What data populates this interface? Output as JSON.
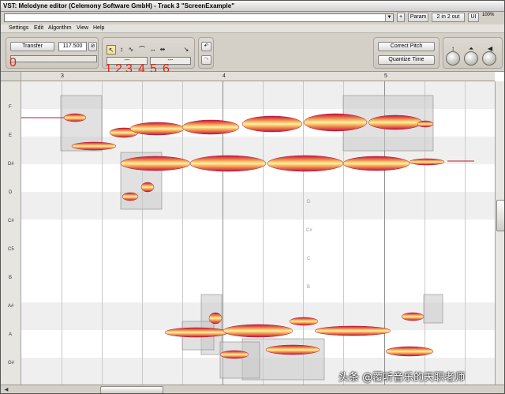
{
  "window": {
    "title": "VST: Melodyne editor (Celemony Software GmbH) - Track 3 \"ScreenExample\""
  },
  "topbar": {
    "plus_label": "+",
    "param_label": "Param",
    "io_label": "2 in 2 out",
    "ui_label": "UI",
    "percent_label": "100%"
  },
  "menu": {
    "items": [
      "Settings",
      "Edit",
      "Algorithm",
      "View",
      "Help"
    ]
  },
  "toolbar": {
    "transfer_label": "Transfer",
    "tempo_value": "117.500",
    "tool_field_1": "---",
    "tool_field_2": "---",
    "correct_pitch_label": "Correct Pitch",
    "quantize_time_label": "Quantize Time"
  },
  "annotations": {
    "transfer_marker": "0",
    "tool_markers": [
      "1",
      "2",
      "3",
      "4",
      "5",
      "6"
    ]
  },
  "ruler": {
    "bars": [
      "3",
      "4",
      "5"
    ]
  },
  "pitch_keys": [
    "F",
    "E",
    "D#",
    "D",
    "C#",
    "C5",
    "B",
    "A#",
    "A",
    "G#"
  ],
  "ghost_labels": [
    "D",
    "C#",
    "C",
    "B"
  ],
  "watermark": "头条 @覆听音乐的天职老师",
  "colors": {
    "blob_outer": "#c8103a",
    "blob_inner": "#fff1a8",
    "note_box": "#c8c8c8"
  }
}
